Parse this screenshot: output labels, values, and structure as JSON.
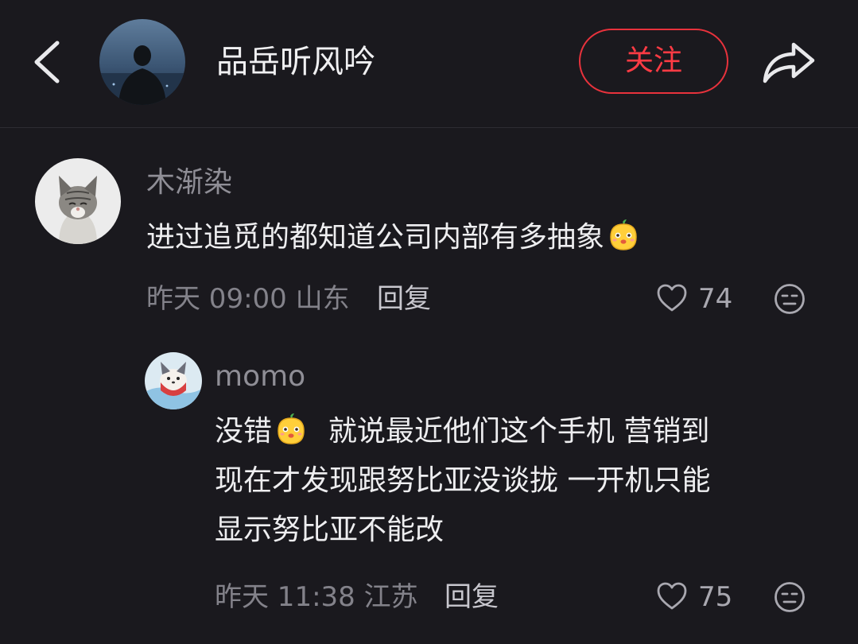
{
  "header": {
    "author_name": "品岳听风吟",
    "follow_label": "关注"
  },
  "comments": [
    {
      "username": "木渐染",
      "text": "进过追觅的都知道公司内部有多抽象",
      "emoji": "fruit-face-emoji",
      "time": "昨天 09:00",
      "location": "山东",
      "reply_label": "回复",
      "likes": "74"
    },
    {
      "username": "momo",
      "text_lines": [
        "没错",
        "就说最近他们这个手机 营销到",
        "现在才发现跟努比亚没谈拢  一开机只能",
        "显示努比亚不能改"
      ],
      "emoji": "fruit-face-emoji",
      "time": "昨天 11:38",
      "location": "江苏",
      "reply_label": "回复",
      "likes": "75"
    }
  ],
  "icons": {
    "back": "chevron-left-icon",
    "share": "share-arrow-icon",
    "like": "heart-outline-icon",
    "dislike": "unamused-face-icon"
  },
  "colors": {
    "background": "#1a191e",
    "follow_accent": "#e8323c"
  }
}
